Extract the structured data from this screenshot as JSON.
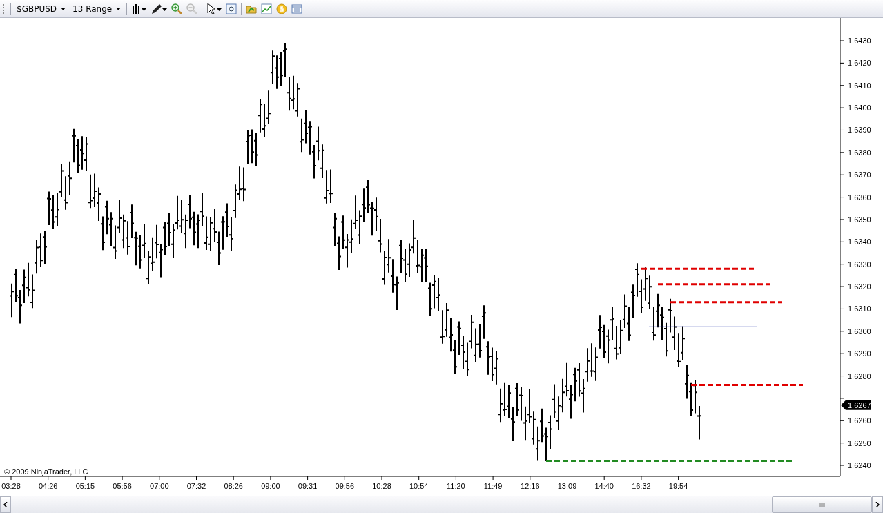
{
  "toolbar": {
    "instrument": "$GBPUSD",
    "period": "13 Range"
  },
  "price_axis": {
    "ticks": [
      "1.6430",
      "1.6420",
      "1.6410",
      "1.6400",
      "1.6390",
      "1.6380",
      "1.6370",
      "1.6360",
      "1.6350",
      "1.6340",
      "1.6330",
      "1.6320",
      "1.6310",
      "1.6300",
      "1.6290",
      "1.6280",
      "1.6260",
      "1.6250",
      "1.6240"
    ],
    "current_price": "1.6267"
  },
  "time_axis": {
    "ticks": [
      "03:28",
      "04:26",
      "05:15",
      "05:56",
      "07:00",
      "07:32",
      "08:26",
      "09:00",
      "09:31",
      "09:56",
      "10:28",
      "10:54",
      "11:20",
      "11:49",
      "12:16",
      "13:09",
      "14:40",
      "16:32",
      "19:54"
    ]
  },
  "copyright": "© 2009 NinjaTrader, LLC"
}
